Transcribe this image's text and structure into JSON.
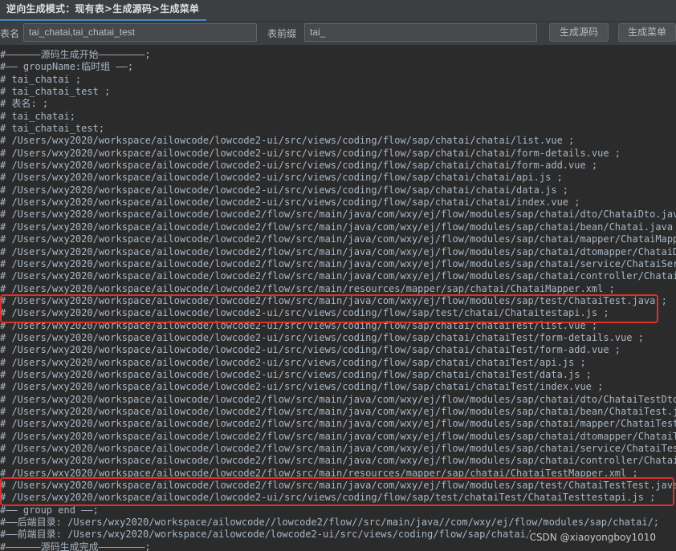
{
  "tab": {
    "label": "逆向生成模式：现有表>生成源码>生成菜单"
  },
  "form": {
    "table_label": "表名",
    "table_value": "tai_chatai,tai_chatai_test",
    "prefix_label": "表前缀",
    "prefix_value": "tai_",
    "generate_source_label": "生成源码",
    "generate_menu_label": "生成菜单"
  },
  "code_lines": [
    "#——————源码生成开始————————;",
    "#—— groupName:临时组 ——;",
    "# tai_chatai ;",
    "# tai_chatai_test ;",
    "# 表名: ;",
    "# tai_chatai;",
    "# tai_chatai_test;",
    "# /Users/wxy2020/workspace/ailowcode/lowcode2-ui/src/views/coding/flow/sap/chatai/chatai/list.vue ;",
    "# /Users/wxy2020/workspace/ailowcode/lowcode2-ui/src/views/coding/flow/sap/chatai/chatai/form-details.vue ;",
    "# /Users/wxy2020/workspace/ailowcode/lowcode2-ui/src/views/coding/flow/sap/chatai/chatai/form-add.vue ;",
    "# /Users/wxy2020/workspace/ailowcode/lowcode2-ui/src/views/coding/flow/sap/chatai/chatai/api.js ;",
    "# /Users/wxy2020/workspace/ailowcode/lowcode2-ui/src/views/coding/flow/sap/chatai/chatai/data.js ;",
    "# /Users/wxy2020/workspace/ailowcode/lowcode2-ui/src/views/coding/flow/sap/chatai/chatai/index.vue ;",
    "# /Users/wxy2020/workspace/ailowcode/lowcode2/flow/src/main/java/com/wxy/ej/flow/modules/sap/chatai/dto/ChataiDto.java ;",
    "# /Users/wxy2020/workspace/ailowcode/lowcode2/flow/src/main/java/com/wxy/ej/flow/modules/sap/chatai/bean/Chatai.java ;",
    "# /Users/wxy2020/workspace/ailowcode/lowcode2/flow/src/main/java/com/wxy/ej/flow/modules/sap/chatai/mapper/ChataiMapper.java ;",
    "# /Users/wxy2020/workspace/ailowcode/lowcode2/flow/src/main/java/com/wxy/ej/flow/modules/sap/chatai/dtomapper/ChataiDtoMapper.java ;",
    "# /Users/wxy2020/workspace/ailowcode/lowcode2/flow/src/main/java/com/wxy/ej/flow/modules/sap/chatai/service/ChataiService.java ;",
    "# /Users/wxy2020/workspace/ailowcode/lowcode2/flow/src/main/java/com/wxy/ej/flow/modules/sap/chatai/controller/ChataiController.java ;",
    "# /Users/wxy2020/workspace/ailowcode/lowcode2/flow/src/main/resources/mapper/sap/chatai/ChataiMapper.xml ;",
    "# /Users/wxy2020/workspace/ailowcode/lowcode2/flow/src/main/java/com/wxy/ej/flow/modules/sap/test/ChataiTest.java ;",
    "# /Users/wxy2020/workspace/ailowcode/lowcode2-ui/src/views/coding/flow/sap/test/chatai/Chataitestapi.js ;",
    "# /Users/wxy2020/workspace/ailowcode/lowcode2-ui/src/views/coding/flow/sap/chatai/chataiTest/list.vue ;",
    "# /Users/wxy2020/workspace/ailowcode/lowcode2-ui/src/views/coding/flow/sap/chatai/chataiTest/form-details.vue ;",
    "# /Users/wxy2020/workspace/ailowcode/lowcode2-ui/src/views/coding/flow/sap/chatai/chataiTest/form-add.vue ;",
    "# /Users/wxy2020/workspace/ailowcode/lowcode2-ui/src/views/coding/flow/sap/chatai/chataiTest/api.js ;",
    "# /Users/wxy2020/workspace/ailowcode/lowcode2-ui/src/views/coding/flow/sap/chatai/chataiTest/data.js ;",
    "# /Users/wxy2020/workspace/ailowcode/lowcode2-ui/src/views/coding/flow/sap/chatai/chataiTest/index.vue ;",
    "# /Users/wxy2020/workspace/ailowcode/lowcode2/flow/src/main/java/com/wxy/ej/flow/modules/sap/chatai/dto/ChataiTestDto.java ;",
    "# /Users/wxy2020/workspace/ailowcode/lowcode2/flow/src/main/java/com/wxy/ej/flow/modules/sap/chatai/bean/ChataiTest.java ;",
    "# /Users/wxy2020/workspace/ailowcode/lowcode2/flow/src/main/java/com/wxy/ej/flow/modules/sap/chatai/mapper/ChataiTestMapper.java ;",
    "# /Users/wxy2020/workspace/ailowcode/lowcode2/flow/src/main/java/com/wxy/ej/flow/modules/sap/chatai/dtomapper/ChataiTestDtoMapper.java ;",
    "# /Users/wxy2020/workspace/ailowcode/lowcode2/flow/src/main/java/com/wxy/ej/flow/modules/sap/chatai/service/ChataiTestService.java ;",
    "# /Users/wxy2020/workspace/ailowcode/lowcode2/flow/src/main/java/com/wxy/ej/flow/modules/sap/chatai/controller/ChataiTestController.java ;",
    "# /Users/wxy2020/workspace/ailowcode/lowcode2/flow/src/main/resources/mapper/sap/chatai/ChataiTestMapper.xml ;",
    "# /Users/wxy2020/workspace/ailowcode/lowcode2/flow/src/main/java/com/wxy/ej/flow/modules/sap/test/ChataiTestTest.java ;",
    "# /Users/wxy2020/workspace/ailowcode/lowcode2-ui/src/views/coding/flow/sap/test/chataiTest/ChataiTesttestapi.js ;",
    "#—— group end ——;",
    "#——后端目录: /Users/wxy2020/workspace/ailowcode//lowcode2/flow//src/main/java//com/wxy/ej/flow/modules/sap/chatai/;",
    "#——前端目录: /Users/wxy2020/workspace/ailowcode/lowcode2-ui/src/views/coding/flow/sap/chatai/;",
    "#——————源码生成完成————————;"
  ],
  "watermark": "CSDN @xiaoyongboy1010",
  "colors": {
    "highlight_box": "#e0302a",
    "tab_underline": "#4a88c7",
    "editor_bg": "#2b2b2b",
    "text": "#a9b7c6"
  }
}
